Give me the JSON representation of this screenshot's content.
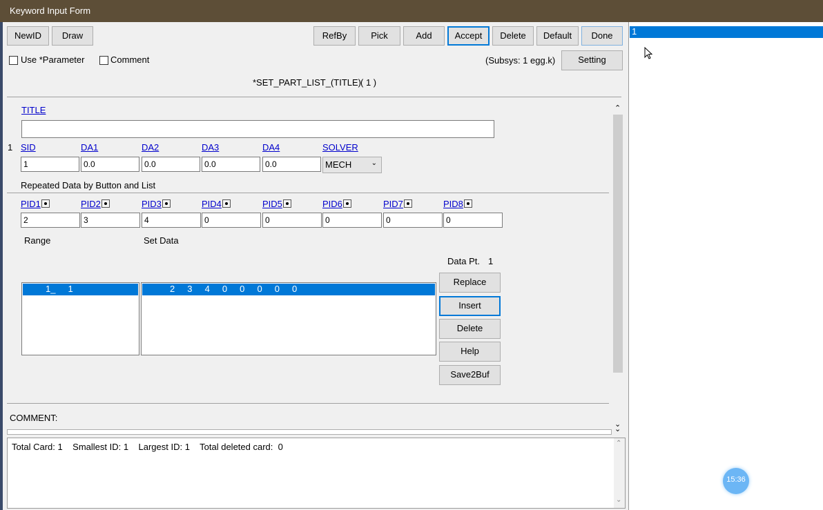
{
  "window": {
    "title": "Keyword Input Form"
  },
  "toolbar": {
    "newid": "NewID",
    "draw": "Draw",
    "refby": "RefBy",
    "pick": "Pick",
    "add": "Add",
    "accept": "Accept",
    "delete": "Delete",
    "default": "Default",
    "done": "Done"
  },
  "options": {
    "use_parameter": "Use *Parameter",
    "comment": "Comment",
    "subsys": "(Subsys: 1 egg.k)",
    "setting": "Setting"
  },
  "keyword": {
    "name": "*SET_PART_LIST_(TITLE)",
    "count": "( 1 )"
  },
  "card1": {
    "title_label": "TITLE",
    "title_value": ""
  },
  "card2": {
    "row_number": "1",
    "sid_label": "SID",
    "sid_value": "1",
    "da1_label": "DA1",
    "da1_value": "0.0",
    "da2_label": "DA2",
    "da2_value": "0.0",
    "da3_label": "DA3",
    "da3_value": "0.0",
    "da4_label": "DA4",
    "da4_value": "0.0",
    "solver_label": "SOLVER",
    "solver_value": "MECH"
  },
  "repeated": {
    "heading": "Repeated Data by Button and List",
    "pids": [
      {
        "label": "PID1",
        "value": "2"
      },
      {
        "label": "PID2",
        "value": "3"
      },
      {
        "label": "PID3",
        "value": "4"
      },
      {
        "label": "PID4",
        "value": "0"
      },
      {
        "label": "PID5",
        "value": "0"
      },
      {
        "label": "PID6",
        "value": "0"
      },
      {
        "label": "PID7",
        "value": "0"
      },
      {
        "label": "PID8",
        "value": "0"
      }
    ],
    "range_label": "Range",
    "set_data_label": "Set Data",
    "data_pt_label": "Data Pt.",
    "data_pt_value": "1",
    "range_row": "1_     1",
    "set_data_row": "2     3     4     0     0     0     0     0",
    "buttons": {
      "replace": "Replace",
      "insert": "Insert",
      "delete": "Delete",
      "help": "Help",
      "save2buf": "Save2Buf"
    }
  },
  "comment_label": "COMMENT:",
  "status": "Total Card: 1    Smallest ID: 1    Largest ID: 1    Total deleted card:  0",
  "id_list": {
    "items": [
      "1"
    ]
  },
  "clock": {
    "time": "15:36"
  },
  "colors": {
    "titlebar": "#5d4e37",
    "selection": "#0078d7",
    "link": "#0000cc"
  }
}
